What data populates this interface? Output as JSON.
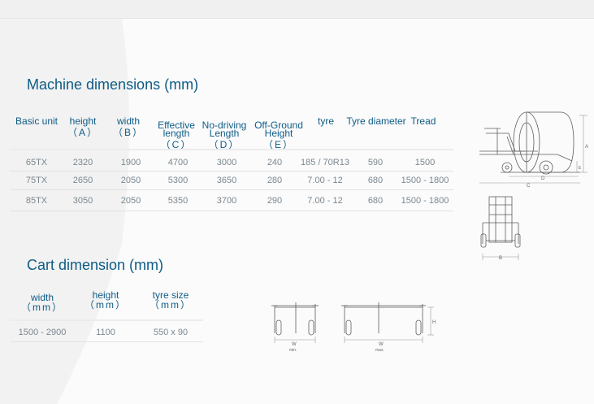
{
  "machine": {
    "title": "Machine dimensions (mm)",
    "headers": [
      {
        "l1": "Basic unit",
        "l2": ""
      },
      {
        "l1": "height",
        "l2": "（A）"
      },
      {
        "l1": "width",
        "l2": "（B）"
      },
      {
        "l1": "Effective\nlength",
        "l2": "（C）"
      },
      {
        "l1": "No-driving\nLength",
        "l2": "（D）"
      },
      {
        "l1": "Off-Ground\nHeight",
        "l2": "（E）"
      },
      {
        "l1": "tyre",
        "l2": ""
      },
      {
        "l1": "Tyre diameter",
        "l2": ""
      },
      {
        "l1": "Tread",
        "l2": ""
      }
    ],
    "rows": [
      [
        "65TX",
        "2320",
        "1900",
        "4700",
        "3000",
        "240",
        "185 / 70R13",
        "590",
        "1500"
      ],
      [
        "75TX",
        "2650",
        "2050",
        "5300",
        "3650",
        "280",
        "7.00 - 12",
        "680",
        "1500 - 1800"
      ],
      [
        "85TX",
        "3050",
        "2050",
        "5350",
        "3700",
        "290",
        "7.00 - 12",
        "680",
        "1500 - 1800"
      ]
    ]
  },
  "cart": {
    "title": "Cart dimension (mm)",
    "headers": [
      {
        "l1": "width",
        "l2": "（mm）"
      },
      {
        "l1": "height",
        "l2": "（mm）"
      },
      {
        "l1": "tyre size",
        "l2": "（mm）"
      }
    ],
    "row": [
      "1500 - 2900",
      "1100",
      "550 x 90"
    ]
  },
  "diagram_labels": {
    "side_a": "A",
    "side_d": "D",
    "side_c": "C",
    "side_e": "E",
    "front_b": "B",
    "cart_h": "H",
    "cart_w_min": "W",
    "cart_min": "min.",
    "cart_w_max": "W",
    "cart_max": "max."
  }
}
